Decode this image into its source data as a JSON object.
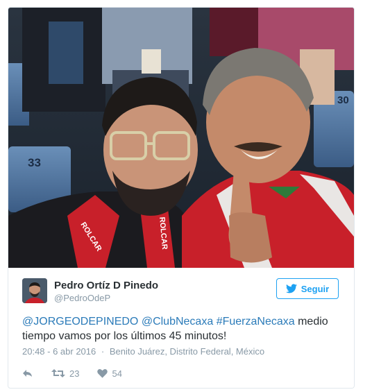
{
  "user": {
    "name": "Pedro Ortíz D Pinedo",
    "handle": "@PedroOdeP"
  },
  "follow_button": {
    "label": "Seguir",
    "icon": "twitter-bird-icon"
  },
  "tweet": {
    "mention": "@JORGEODEPINEDO",
    "mention2": "@ClubNecaxa",
    "hashtag": "#FuerzaNecaxa",
    "text_after": "medio tiempo vamos por los últimos 45 minutos!"
  },
  "meta": {
    "time": "20:48 - 6 abr 2016",
    "separator": "·",
    "location": "Benito Juárez, Distrito Federal, México"
  },
  "stats": {
    "retweets": "23",
    "likes": "54"
  },
  "photo": {
    "seat_labels": [
      "33",
      "30"
    ],
    "jersey_text_left": "ROLCAR",
    "jersey_text_right": "ROLCAR"
  },
  "colors": {
    "link": "#2b7bb9",
    "follow": "#1da1f2",
    "muted": "#8899a6",
    "jersey_red": "#c8202a"
  }
}
